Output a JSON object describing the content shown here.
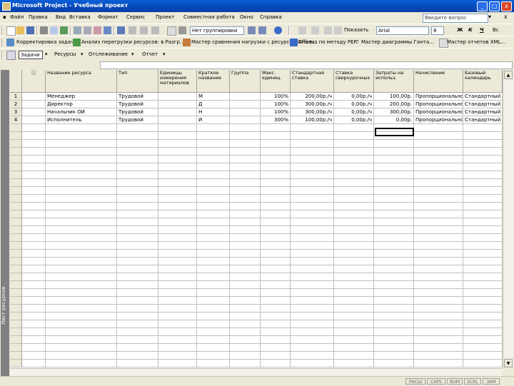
{
  "window": {
    "title": "Microsoft Project - Учебный проект",
    "min": "_",
    "max": "□",
    "close": "x"
  },
  "menu": {
    "items": [
      "Файл",
      "Правка",
      "Вид",
      "Вставка",
      "Формат",
      "Сервис",
      "Проект",
      "Совместная работа",
      "Окно",
      "Справка"
    ],
    "ask_placeholder": "Введите вопрос",
    "help_arrow": "▾",
    "close_glyph": "x"
  },
  "toolbar1": {
    "group_combo": "Нет группировки",
    "show_label": "Показать",
    "font": "Arial",
    "size": "8",
    "bold": "Ж",
    "italic": "К",
    "underline": "Ч",
    "filter": "Вс"
  },
  "toolbar2": {
    "items": [
      "Корректировка задач",
      "Анализ перегрузки ресурсов: в Разгр...",
      "Мастер сравнения нагрузки с ресурсом Office...",
      "Анализ по методу PERT...",
      "Мастер диаграммы Ганта...",
      "Мастер отчетов XML..."
    ]
  },
  "toolbar3": {
    "tasks": "Задачи",
    "resources": "Ресурсы",
    "tracking": "Отслеживание",
    "report": "Отчет"
  },
  "table": {
    "headers": [
      "",
      "ⓘ",
      "Название ресурса",
      "Тип",
      "Единицы измерения материалов",
      "Краткое название",
      "Группа",
      "Макс. единиц",
      "Стандартная ставка",
      "Ставка сверхурочных",
      "Затраты на использ.",
      "Начисление",
      "Базовый календарь"
    ],
    "rows": [
      [
        "1",
        "",
        "Менеджер",
        "Трудовой",
        "",
        "М",
        "",
        "100%",
        "200,00р./ч",
        "0,00р./ч",
        "100,00р.",
        "Пропорциональное",
        "Стандартный"
      ],
      [
        "2",
        "",
        "Директор",
        "Трудовой",
        "",
        "Д",
        "",
        "100%",
        "300,00р./ч",
        "0,00р./ч",
        "200,00р.",
        "Пропорциональное",
        "Стандартный"
      ],
      [
        "3",
        "",
        "Начальник ОИ",
        "Трудовой",
        "",
        "Н",
        "",
        "100%",
        "300,00р./ч",
        "0,00р./ч",
        "300,00р.",
        "Пропорциональное",
        "Стандартный"
      ],
      [
        "4",
        "",
        "Исполнитель",
        "Трудовой",
        "",
        "И",
        "",
        "300%",
        "100,00р./ч",
        "0,00р./ч",
        "0,00р.",
        "Пропорциональное",
        "Стандартный"
      ]
    ]
  },
  "view_label": "Лист ресурсов",
  "status": [
    "РАСШ",
    "CAPS",
    "NUM",
    "SCRL",
    "ЗАМ"
  ],
  "colors": {
    "title_blue": "#0a5fd8",
    "chrome": "#ece9d8",
    "viewbar": "#808080"
  }
}
